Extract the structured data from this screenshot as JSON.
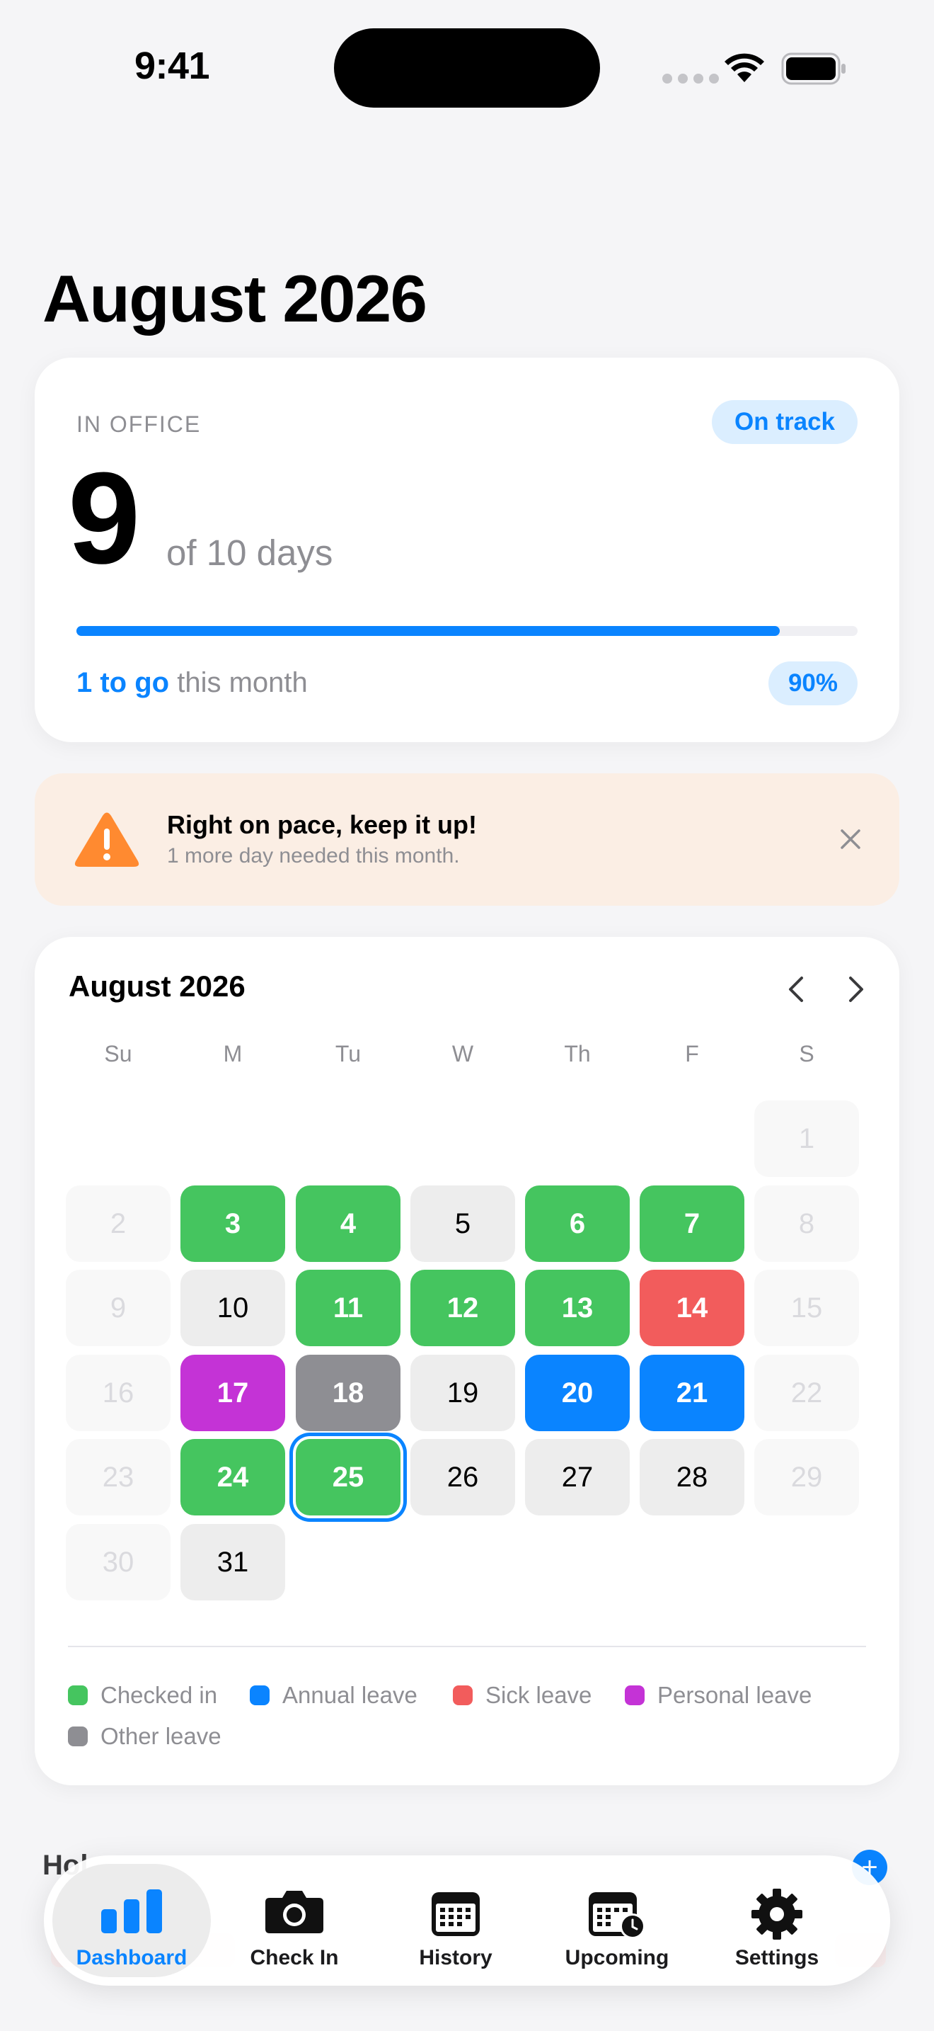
{
  "status_bar": {
    "time": "9:41"
  },
  "page_title": "August 2026",
  "summary": {
    "label": "IN OFFICE",
    "status": "On track",
    "count": "9",
    "count_suffix": "of 10 days",
    "progress_fraction": 0.9,
    "remaining_value": "1 to go",
    "remaining_suffix": " this month",
    "percent": "90%"
  },
  "alert": {
    "title": "Right on pace, keep it up!",
    "subtitle": "1 more day needed this month."
  },
  "calendar": {
    "title": "August 2026",
    "weekdays": [
      "Su",
      "M",
      "Tu",
      "W",
      "Th",
      "F",
      "S"
    ],
    "leading_blank_days": 6,
    "days": [
      {
        "d": "1",
        "s": "weekend"
      },
      {
        "d": "2",
        "s": "weekend"
      },
      {
        "d": "3",
        "s": "checked"
      },
      {
        "d": "4",
        "s": "checked"
      },
      {
        "d": "5",
        "s": "plain"
      },
      {
        "d": "6",
        "s": "checked"
      },
      {
        "d": "7",
        "s": "checked"
      },
      {
        "d": "8",
        "s": "weekend"
      },
      {
        "d": "9",
        "s": "weekend"
      },
      {
        "d": "10",
        "s": "plain"
      },
      {
        "d": "11",
        "s": "checked"
      },
      {
        "d": "12",
        "s": "checked"
      },
      {
        "d": "13",
        "s": "checked"
      },
      {
        "d": "14",
        "s": "sick"
      },
      {
        "d": "15",
        "s": "weekend"
      },
      {
        "d": "16",
        "s": "weekend"
      },
      {
        "d": "17",
        "s": "personal"
      },
      {
        "d": "18",
        "s": "other"
      },
      {
        "d": "19",
        "s": "plain"
      },
      {
        "d": "20",
        "s": "annual"
      },
      {
        "d": "21",
        "s": "annual"
      },
      {
        "d": "22",
        "s": "weekend"
      },
      {
        "d": "23",
        "s": "weekend"
      },
      {
        "d": "24",
        "s": "checked"
      },
      {
        "d": "25",
        "s": "checked",
        "today": true
      },
      {
        "d": "26",
        "s": "plain"
      },
      {
        "d": "27",
        "s": "plain"
      },
      {
        "d": "28",
        "s": "plain"
      },
      {
        "d": "29",
        "s": "weekend"
      },
      {
        "d": "30",
        "s": "weekend"
      },
      {
        "d": "31",
        "s": "plain"
      }
    ],
    "legend": [
      {
        "label": "Checked in",
        "color": "#45c55f"
      },
      {
        "label": "Annual leave",
        "color": "#0a84ff"
      },
      {
        "label": "Sick leave",
        "color": "#f25c5c"
      },
      {
        "label": "Personal leave",
        "color": "#c433d6"
      },
      {
        "label": "Other leave",
        "color": "#8e8e93"
      }
    ]
  },
  "peek_section": {
    "label": "Hol",
    "add_symbol": "+"
  },
  "tabs": [
    {
      "label": "Dashboard",
      "icon": "bar-chart-icon",
      "active": true
    },
    {
      "label": "Check In",
      "icon": "camera-icon",
      "active": false
    },
    {
      "label": "History",
      "icon": "calendar-icon",
      "active": false
    },
    {
      "label": "Upcoming",
      "icon": "calendar-clock-icon",
      "active": false
    },
    {
      "label": "Settings",
      "icon": "gear-icon",
      "active": false
    }
  ],
  "colors": {
    "accent": "#0a84ff",
    "checked": "#45c55f",
    "sick": "#f25c5c",
    "personal": "#c433d6",
    "other": "#8e8e93",
    "alert_bg": "#fbeee4",
    "warning": "#ff8a30"
  }
}
